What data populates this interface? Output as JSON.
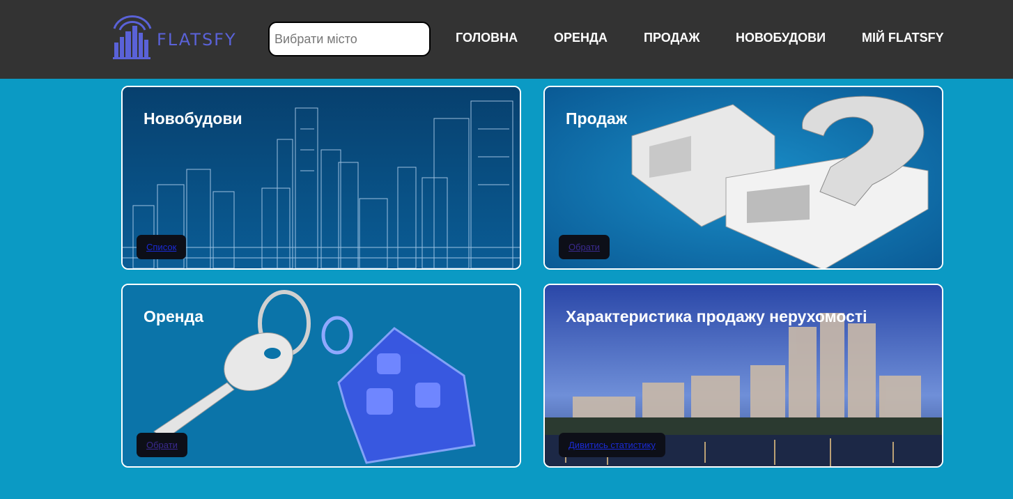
{
  "header": {
    "logo_text": "FLATSFY",
    "search_placeholder": "Вибрати місто",
    "nav": [
      "ГОЛОВНА",
      "ОРЕНДА",
      "ПРОДАЖ",
      "НОВОБУДОВИ",
      "МІЙ FLATSFY"
    ]
  },
  "cards": [
    {
      "title": "Новобудови",
      "button": "Список"
    },
    {
      "title": "Продаж",
      "button": "Обрати"
    },
    {
      "title": "Оренда",
      "button": "Обрати"
    },
    {
      "title": "Характеристика продажу нерухомості",
      "button": "Дивитись статистику"
    }
  ],
  "colors": {
    "background": "#0b9ac4",
    "header": "#333333",
    "logo": "#5a62d8",
    "button": "#0d0f18"
  }
}
